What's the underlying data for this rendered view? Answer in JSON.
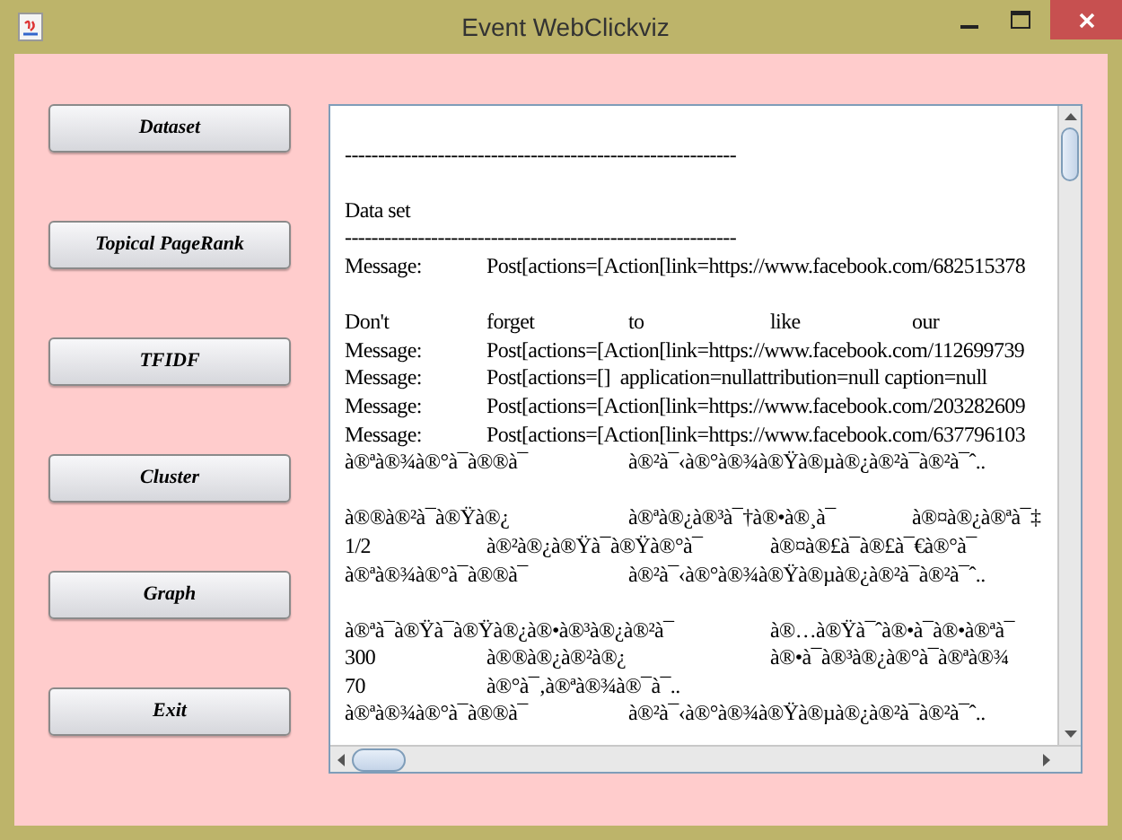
{
  "window": {
    "title": "Event WebClickviz"
  },
  "buttons": [
    "Dataset",
    "Topical PageRank",
    "TFIDF",
    "Cluster",
    "Graph",
    "Exit"
  ],
  "output_lines": [
    {
      "kind": "blank"
    },
    {
      "kind": "text",
      "text": "-----------------------------------------------------------"
    },
    {
      "kind": "blank"
    },
    {
      "kind": "text",
      "text": "Data set"
    },
    {
      "kind": "text",
      "text": "-----------------------------------------------------------"
    },
    {
      "kind": "text",
      "text": "Message:\tPost[actions=[Action[link=https://www.facebook.com/682515378"
    },
    {
      "kind": "blank"
    },
    {
      "kind": "text",
      "text": "Don't\tforget\tto\tlike\tour"
    },
    {
      "kind": "text",
      "text": "Message:\tPost[actions=[Action[link=https://www.facebook.com/112699739"
    },
    {
      "kind": "text",
      "text": "Message:\tPost[actions=[]  application=nullattribution=null caption=null"
    },
    {
      "kind": "text",
      "text": "Message:\tPost[actions=[Action[link=https://www.facebook.com/203282609"
    },
    {
      "kind": "text",
      "text": "Message:\tPost[actions=[Action[link=https://www.facebook.com/637796103"
    },
    {
      "kind": "text",
      "text": "à®ªà®¾à®°à¯à®®à¯\tà®²à¯‹à®°à®¾à®Ÿà®µà®¿à®²à¯à®²à¯ˆ.."
    },
    {
      "kind": "blank"
    },
    {
      "kind": "text",
      "text": "à®®à®²à¯à®Ÿà®¿\tà®ªà®¿à®³à¯†à®•à®¸à¯\tà®¤à®¿à®ªà¯‡"
    },
    {
      "kind": "text",
      "text": "1/2\tà®²à®¿à®Ÿà¯à®Ÿà®°à¯\tà®¤à®£à¯à®£à¯€à®°à¯"
    },
    {
      "kind": "text",
      "text": "à®ªà®¾à®°à¯à®®à¯\tà®²à¯‹à®°à®¾à®Ÿà®µà®¿à®²à¯à®²à¯ˆ.."
    },
    {
      "kind": "blank"
    },
    {
      "kind": "text",
      "text": "à®ªà¯à®Ÿà¯à®Ÿà®¿à®•à®³à®¿à®²à¯\tà®…à®Ÿà¯ˆà®•à¯à®•à®ªà¯"
    },
    {
      "kind": "text",
      "text": "300\tà®®à®¿à®²à®¿\tà®•à¯à®³à®¿à®°à¯à®ªà®¾"
    },
    {
      "kind": "text",
      "text": "70\tà®°à¯‚à®ªà®¾à®¯à¯.."
    },
    {
      "kind": "text",
      "text": "à®ªà®¾à®°à¯à®®à¯\tà®²à¯‹à®°à®¾à®Ÿà®µà®¿à®²à¯à®²à¯ˆ.."
    }
  ]
}
